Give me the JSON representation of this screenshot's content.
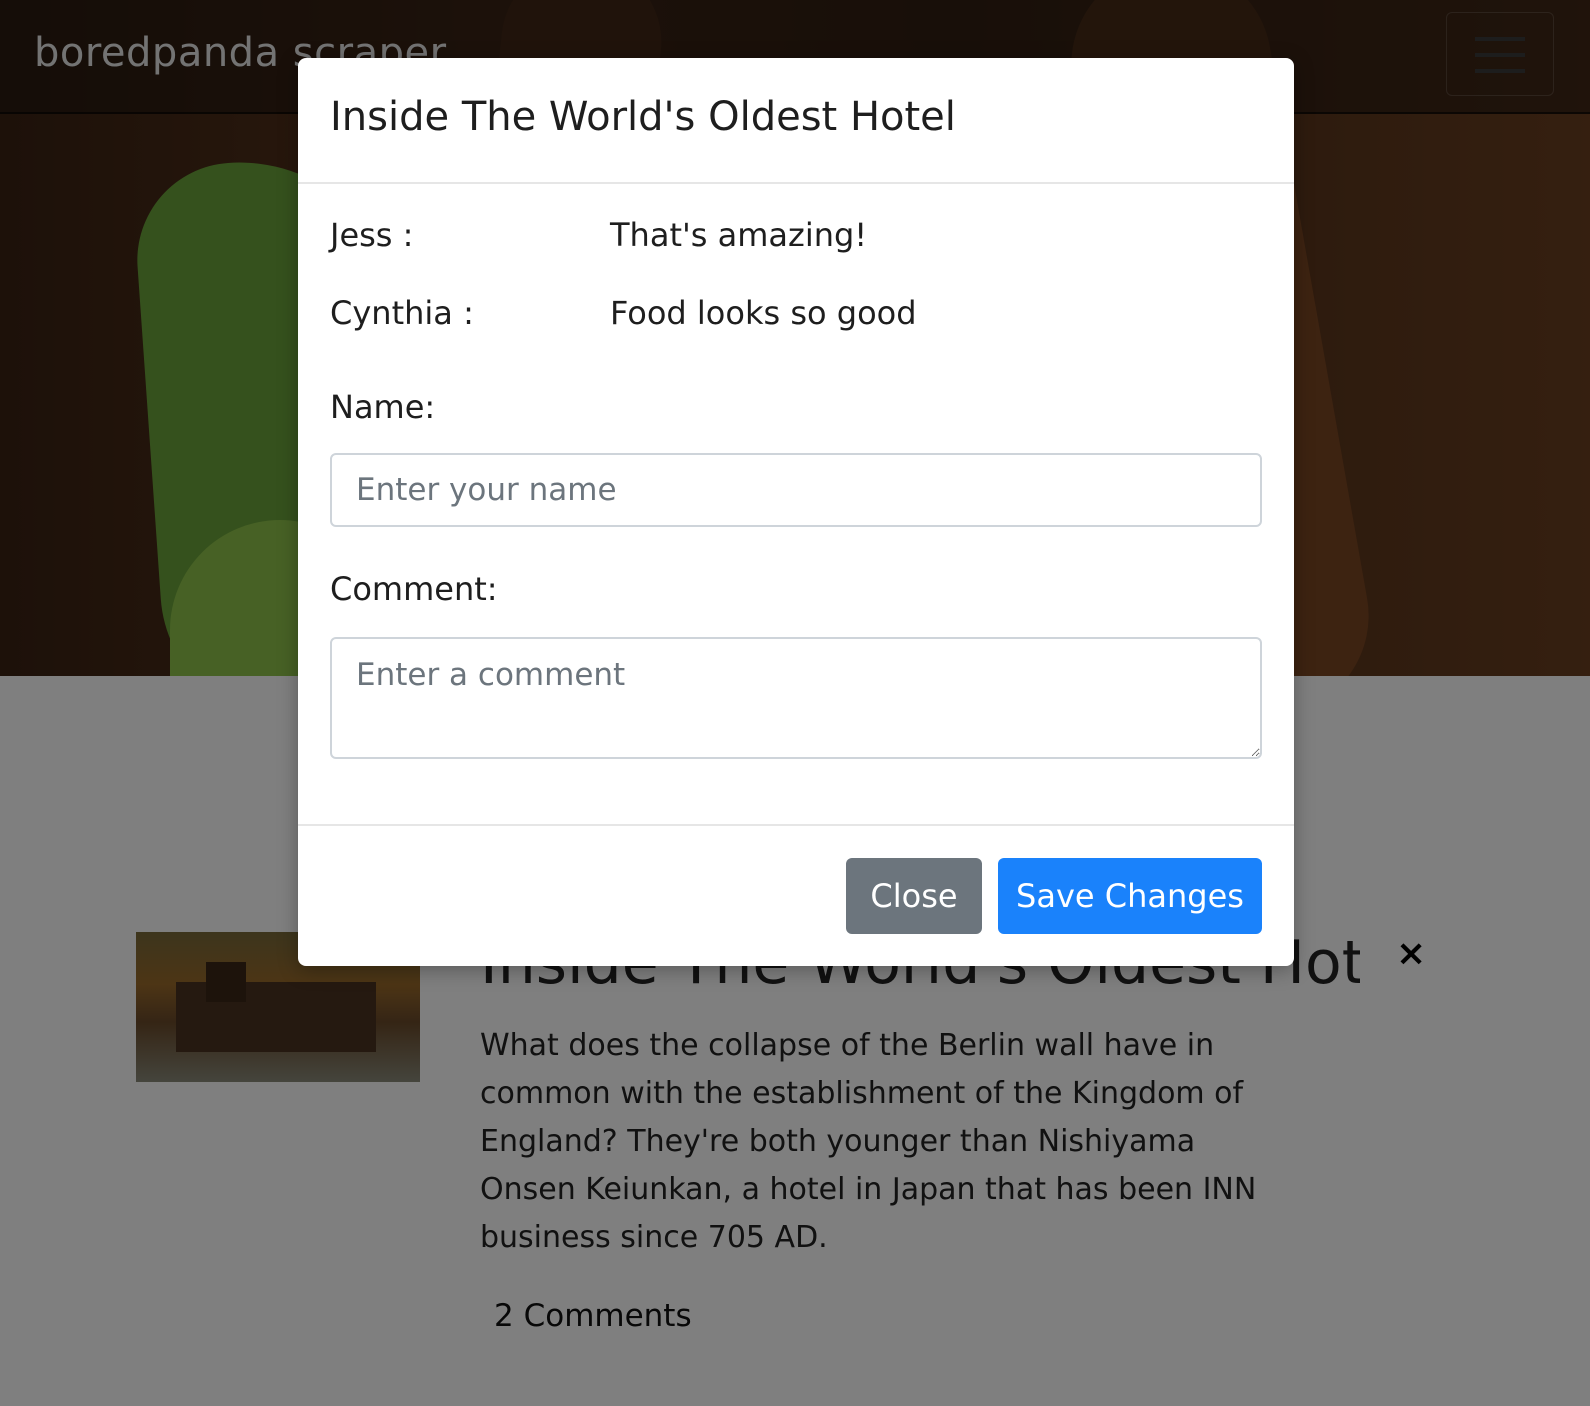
{
  "navbar": {
    "brand": "boredpanda scraper"
  },
  "article": {
    "title": "Inside The World's Oldest Hotel",
    "description": "What does the collapse of the Berlin wall have in common with the establishment of the Kingdom of England? They're both younger than Nishiyama Onsen Keiunkan, a hotel in Japan that has been INN business since 705 AD.",
    "comments_link": "2 Comments",
    "dismiss": "×"
  },
  "modal": {
    "title": "Inside The World's Oldest Hotel",
    "comments": [
      {
        "name": "Jess :",
        "text": "That's amazing!"
      },
      {
        "name": "Cynthia :",
        "text": "Food looks so good"
      }
    ],
    "name_label": "Name:",
    "name_placeholder": "Enter your name",
    "comment_label": "Comment:",
    "comment_placeholder": "Enter a comment",
    "close_label": "Close",
    "save_label": "Save Changes"
  },
  "colors": {
    "primary": "#1a82fb",
    "secondary": "#6c757d"
  }
}
